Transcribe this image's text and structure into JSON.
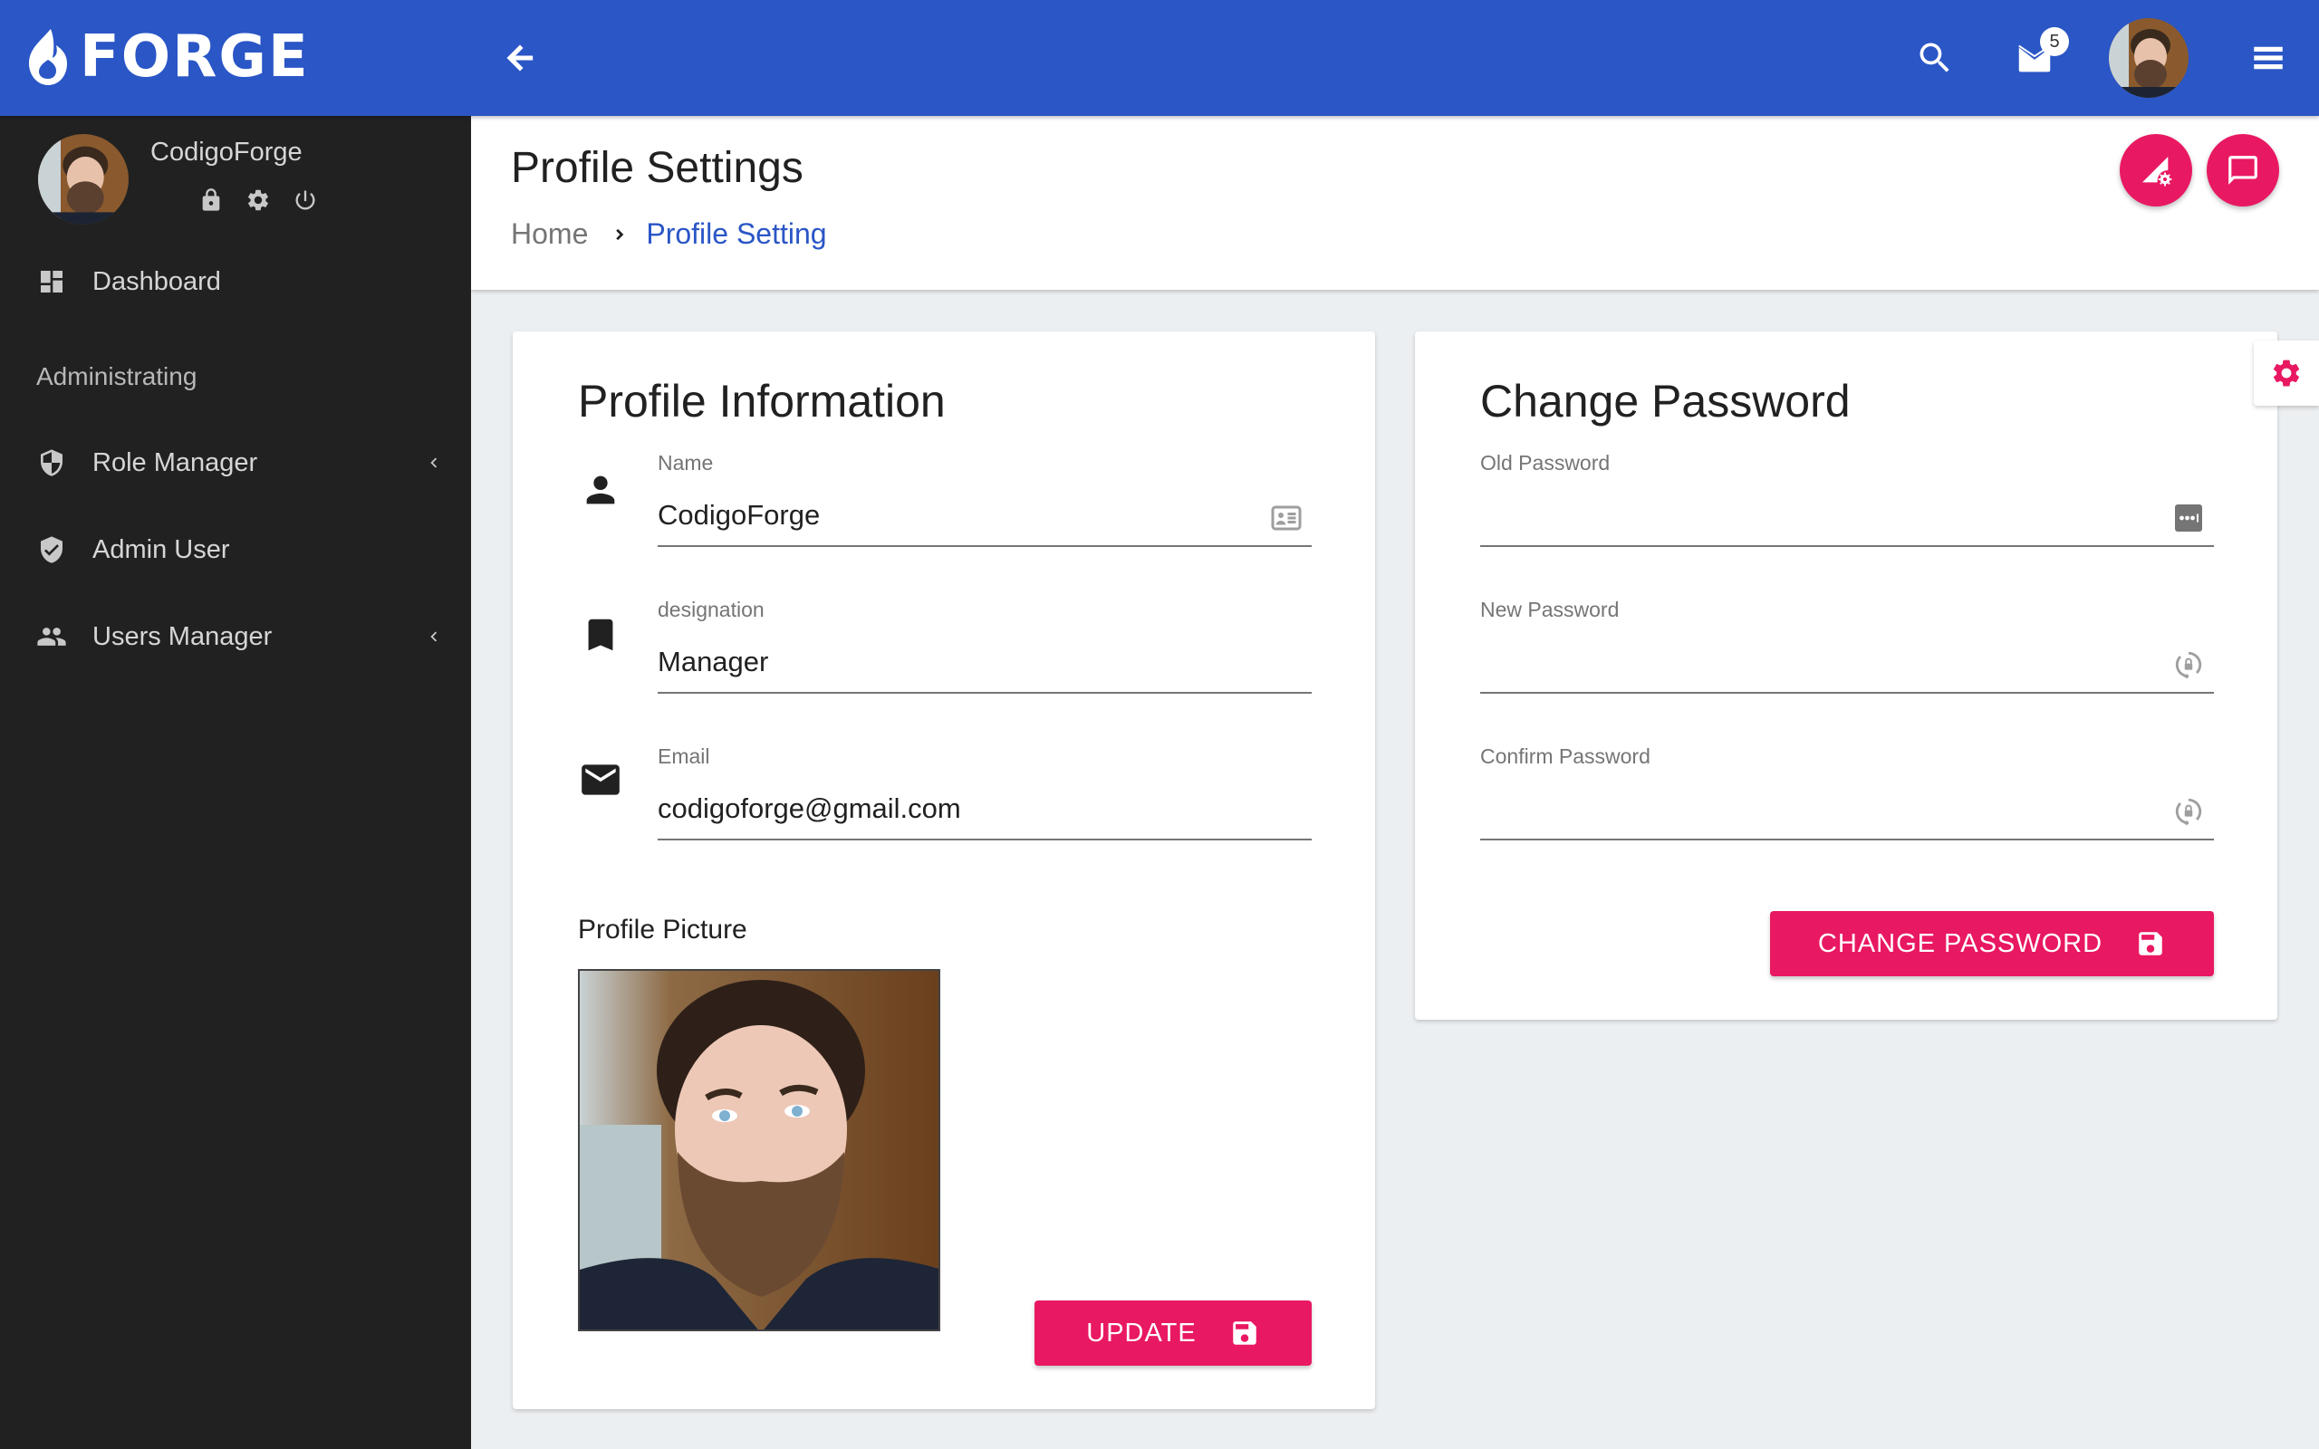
{
  "app": {
    "brand": "FORGE",
    "colors": {
      "primary": "#2a56c6",
      "accent": "#e91863",
      "sidebar_bg": "#212121",
      "page_bg": "#eceff1"
    }
  },
  "topbar": {
    "back_icon": "arrow-left-icon",
    "search_icon": "search-icon",
    "mail_icon": "mail-icon",
    "mail_badge_count": "5",
    "avatar_alt": "user avatar",
    "menu_icon": "menu-icon"
  },
  "sidebar": {
    "username": "CodigoForge",
    "user_actions": [
      "lock-icon",
      "gear-icon",
      "power-icon"
    ],
    "section_label": "Administrating",
    "items": [
      {
        "label": "Dashboard",
        "icon": "dashboard-icon",
        "has_children": false
      },
      {
        "label": "Role Manager",
        "icon": "shield-half-icon",
        "has_children": true
      },
      {
        "label": "Admin User",
        "icon": "shield-check-icon",
        "has_children": false
      },
      {
        "label": "Users Manager",
        "icon": "people-icon",
        "has_children": true
      }
    ]
  },
  "page": {
    "title": "Profile Settings",
    "breadcrumb": {
      "home": "Home",
      "current": "Profile Setting"
    }
  },
  "profile_card": {
    "title": "Profile Information",
    "fields": [
      {
        "label": "Name",
        "value": "CodigoForge",
        "lead_icon": "person-icon",
        "trail_icon": "id-card-icon"
      },
      {
        "label": "designation",
        "value": "Manager",
        "lead_icon": "bookmark-icon",
        "trail_icon": ""
      },
      {
        "label": "Email",
        "value": "codigoforge@gmail.com",
        "lead_icon": "email-icon",
        "trail_icon": ""
      }
    ],
    "picture_label": "Profile Picture",
    "update_button": "UPDATE"
  },
  "password_card": {
    "title": "Change Password",
    "fields": [
      {
        "label": "Old Password",
        "value": "",
        "trail_icon": "password-dots-icon"
      },
      {
        "label": "New Password",
        "value": "",
        "trail_icon": "lock-reset-icon"
      },
      {
        "label": "Confirm Password",
        "value": "",
        "trail_icon": "lock-reset-icon"
      }
    ],
    "change_button": "CHANGE PASSWORD"
  }
}
